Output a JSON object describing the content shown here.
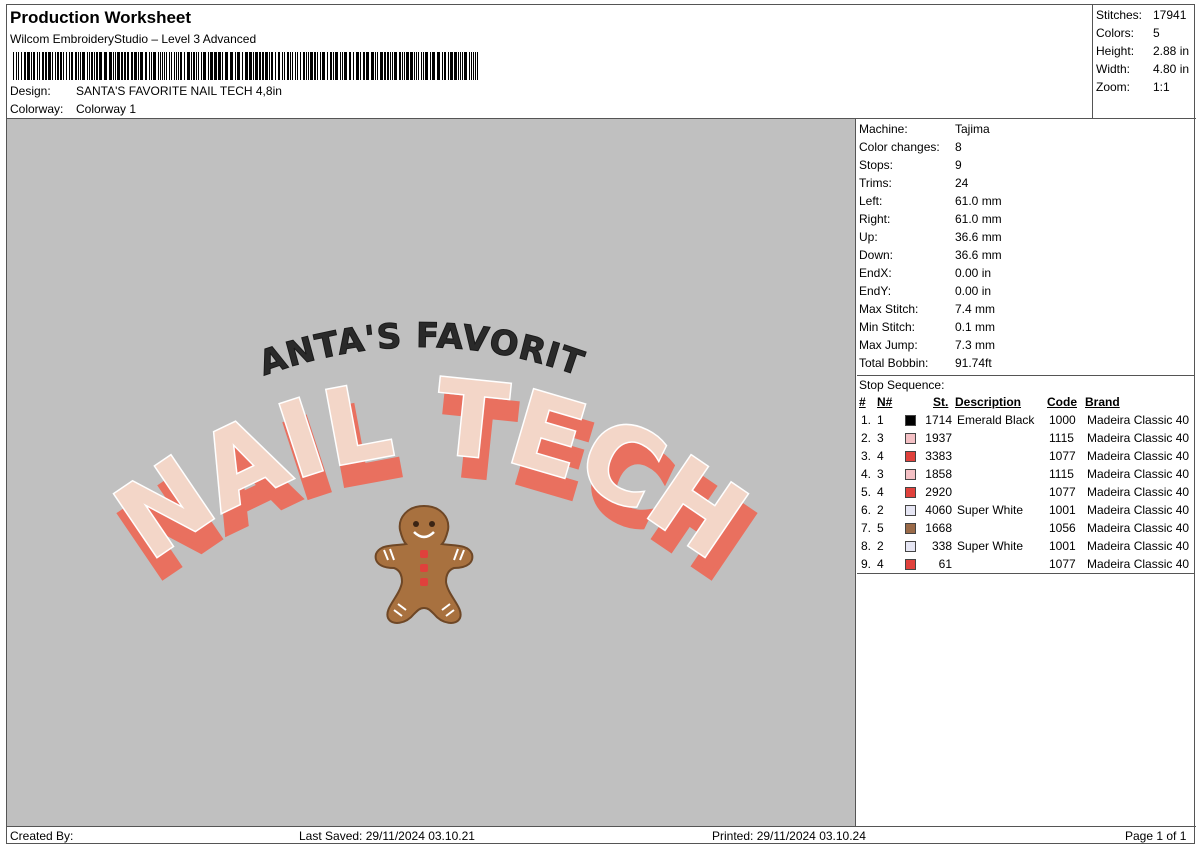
{
  "header": {
    "title": "Production Worksheet",
    "subtitle": "Wilcom EmbroideryStudio – Level 3 Advanced",
    "design_label": "Design:",
    "design_value": "SANTA'S FAVORITE NAIL TECH 4,8in",
    "colorway_label": "Colorway:",
    "colorway_value": "Colorway 1"
  },
  "stats": [
    {
      "label": "Stitches:",
      "value": "17941"
    },
    {
      "label": "Colors:",
      "value": "5"
    },
    {
      "label": "Height:",
      "value": "2.88 in"
    },
    {
      "label": "Width:",
      "value": "4.80 in"
    },
    {
      "label": "Zoom:",
      "value": "1:1"
    }
  ],
  "machine_info": [
    {
      "label": "Machine:",
      "value": "Tajima"
    },
    {
      "label": "Color changes:",
      "value": "8"
    },
    {
      "label": "Stops:",
      "value": "9"
    },
    {
      "label": "Trims:",
      "value": "24"
    },
    {
      "label": "Left:",
      "value": "61.0 mm"
    },
    {
      "label": "Right:",
      "value": "61.0 mm"
    },
    {
      "label": "Up:",
      "value": "36.6 mm"
    },
    {
      "label": "Down:",
      "value": "36.6 mm"
    },
    {
      "label": "EndX:",
      "value": "0.00 in"
    },
    {
      "label": "EndY:",
      "value": "0.00 in"
    },
    {
      "label": "Max Stitch:",
      "value": "7.4 mm"
    },
    {
      "label": "Min Stitch:",
      "value": "0.1 mm"
    },
    {
      "label": "Max Jump:",
      "value": "7.3 mm"
    },
    {
      "label": "Total Bobbin:",
      "value": "91.74ft"
    }
  ],
  "stop_sequence": {
    "title": "Stop Sequence:",
    "columns": {
      "num": "#",
      "needle": "N#",
      "stitches": "St.",
      "description": "Description",
      "code": "Code",
      "brand": "Brand"
    },
    "rows": [
      {
        "num": "1.",
        "needle": "1",
        "color": "#000000",
        "stitches": "1714",
        "description": "Emerald Black",
        "code": "1000",
        "brand": "Madeira Classic 40"
      },
      {
        "num": "2.",
        "needle": "3",
        "color": "#f4c0c4",
        "stitches": "1937",
        "description": "",
        "code": "1115",
        "brand": "Madeira Classic 40"
      },
      {
        "num": "3.",
        "needle": "4",
        "color": "#e0413c",
        "stitches": "3383",
        "description": "",
        "code": "1077",
        "brand": "Madeira Classic 40"
      },
      {
        "num": "4.",
        "needle": "3",
        "color": "#f4c0c4",
        "stitches": "1858",
        "description": "",
        "code": "1115",
        "brand": "Madeira Classic 40"
      },
      {
        "num": "5.",
        "needle": "4",
        "color": "#e0413c",
        "stitches": "2920",
        "description": "",
        "code": "1077",
        "brand": "Madeira Classic 40"
      },
      {
        "num": "6.",
        "needle": "2",
        "color": "#e6e6f4",
        "stitches": "4060",
        "description": "Super White",
        "code": "1001",
        "brand": "Madeira Classic 40"
      },
      {
        "num": "7.",
        "needle": "5",
        "color": "#9a6a48",
        "stitches": "1668",
        "description": "",
        "code": "1056",
        "brand": "Madeira Classic 40"
      },
      {
        "num": "8.",
        "needle": "2",
        "color": "#e6e6f4",
        "stitches": "338",
        "description": "Super White",
        "code": "1001",
        "brand": "Madeira Classic 40"
      },
      {
        "num": "9.",
        "needle": "4",
        "color": "#e0413c",
        "stitches": "61",
        "description": "",
        "code": "1077",
        "brand": "Madeira Classic 40"
      }
    ]
  },
  "artwork": {
    "line1": "SANTA'S FAVORITE",
    "line2": "NAIL TECH",
    "colors": {
      "dark": "#2a2a2a",
      "salmon": "#e9705f",
      "cream": "#f3d6c8",
      "cookie": "#a8713f"
    }
  },
  "footer": {
    "created_by": "Created By:",
    "last_saved": "Last Saved: 29/11/2024 03.10.21",
    "printed": "Printed: 29/11/2024 03.10.24",
    "page": "Page 1 of 1"
  }
}
